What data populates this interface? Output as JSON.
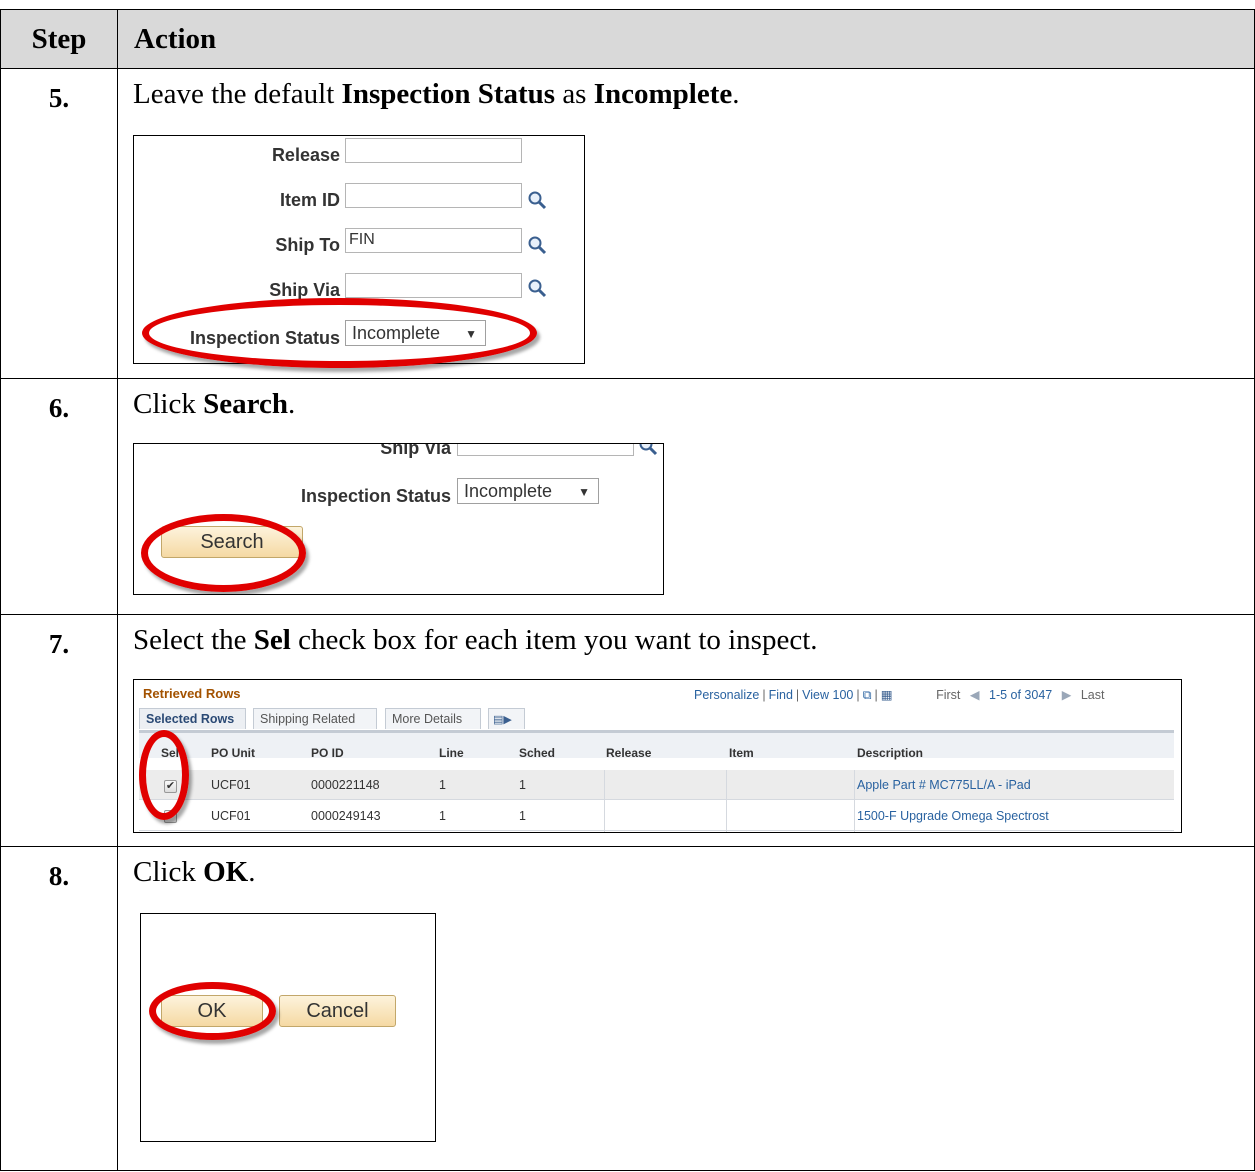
{
  "header": {
    "step": "Step",
    "action": "Action"
  },
  "steps": [
    {
      "num": "5.",
      "text_pre": "Leave the default ",
      "text_b1": "Inspection Status",
      "text_mid": " as ",
      "text_b2": "Incomplete",
      "text_post": ".",
      "form": {
        "release_label": "Release",
        "item_label": "Item ID",
        "shipto_label": "Ship To",
        "shipto_value": "FIN",
        "shipvia_label": "Ship Via",
        "status_label": "Inspection Status",
        "status_value": "Incomplete"
      }
    },
    {
      "num": "6.",
      "text_pre": "Click ",
      "text_b1": "Search",
      "text_post": ".",
      "form": {
        "shipvia_label": "Ship Via",
        "status_label": "Inspection Status",
        "status_value": "Incomplete",
        "search_label": "Search"
      }
    },
    {
      "num": "7.",
      "text_pre": "Select the ",
      "text_b1": "Sel",
      "text_post": " check box for each item you want to inspect.",
      "grid": {
        "title": "Retrieved Rows",
        "personalize": "Personalize",
        "find": "Find",
        "view": "View 100",
        "first": "First",
        "count": "1-5 of 3047",
        "last": "Last",
        "tabs": [
          "Selected Rows",
          "Shipping Related",
          "More Details"
        ],
        "columns": [
          "Sel",
          "PO Unit",
          "PO ID",
          "Line",
          "Sched",
          "Release",
          "Item",
          "Description"
        ],
        "rows": [
          {
            "checked": true,
            "unit": "UCF01",
            "poid": "0000221148",
            "line": "1",
            "sched": "1",
            "release": "",
            "item": "",
            "desc": "Apple Part # MC775LL/A - iPad"
          },
          {
            "checked": false,
            "unit": "UCF01",
            "poid": "0000249143",
            "line": "1",
            "sched": "1",
            "release": "",
            "item": "",
            "desc": "1500-F Upgrade Omega Spectrost"
          }
        ]
      }
    },
    {
      "num": "8.",
      "text_pre": "Click ",
      "text_b1": "OK",
      "text_post": ".",
      "buttons": {
        "ok": "OK",
        "cancel": "Cancel"
      }
    }
  ],
  "colors": {
    "highlight_ring": "#e00000",
    "header_bg": "#d9d9d9",
    "link": "#2962a0",
    "grid_title": "#a35200"
  }
}
